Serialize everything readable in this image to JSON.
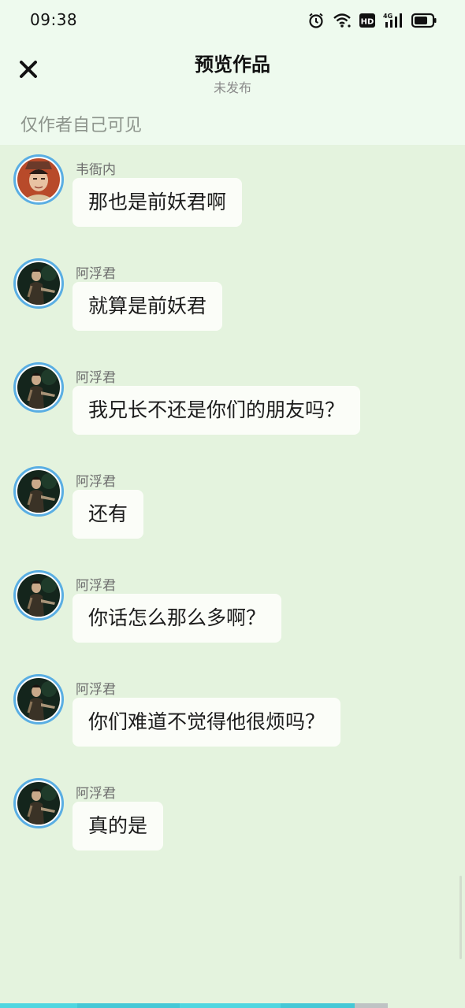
{
  "status_bar": {
    "time": "09:38",
    "icons": [
      "alarm-icon",
      "wifi-icon",
      "hd-icon",
      "signal-4g-icon",
      "battery-icon"
    ],
    "network_label": "4G",
    "hd_label": "HD"
  },
  "header": {
    "title": "预览作品",
    "subtitle": "未发布",
    "close_icon": "close-icon"
  },
  "notice": "仅作者自己可见",
  "messages": [
    {
      "sender": "韦衙内",
      "text": "那也是前妖君啊",
      "avatar": "avatar-weiyanei"
    },
    {
      "sender": "阿浮君",
      "text": "就算是前妖君",
      "avatar": "avatar-afujun"
    },
    {
      "sender": "阿浮君",
      "text": "我兄长不还是你们的朋友吗？",
      "avatar": "avatar-afujun"
    },
    {
      "sender": "阿浮君",
      "text": "还有",
      "avatar": "avatar-afujun"
    },
    {
      "sender": "阿浮君",
      "text": "你话怎么那么多啊？",
      "avatar": "avatar-afujun"
    },
    {
      "sender": "阿浮君",
      "text": "你们难道不觉得他很烦吗？",
      "avatar": "avatar-afujun"
    },
    {
      "sender": "阿浮君",
      "text": "真的是",
      "avatar": "avatar-afujun"
    }
  ],
  "colors": {
    "chat_background": "#e4f3de",
    "header_background": "#eefaee",
    "avatar_ring": "#5aaee3",
    "bubble": "#fbfdf8",
    "progress_segments": [
      "#4fd6e0",
      "#45c8d6",
      "#4fd6e0",
      "#45c8d6",
      "#4fd6e0",
      "#bfc3c4"
    ]
  }
}
